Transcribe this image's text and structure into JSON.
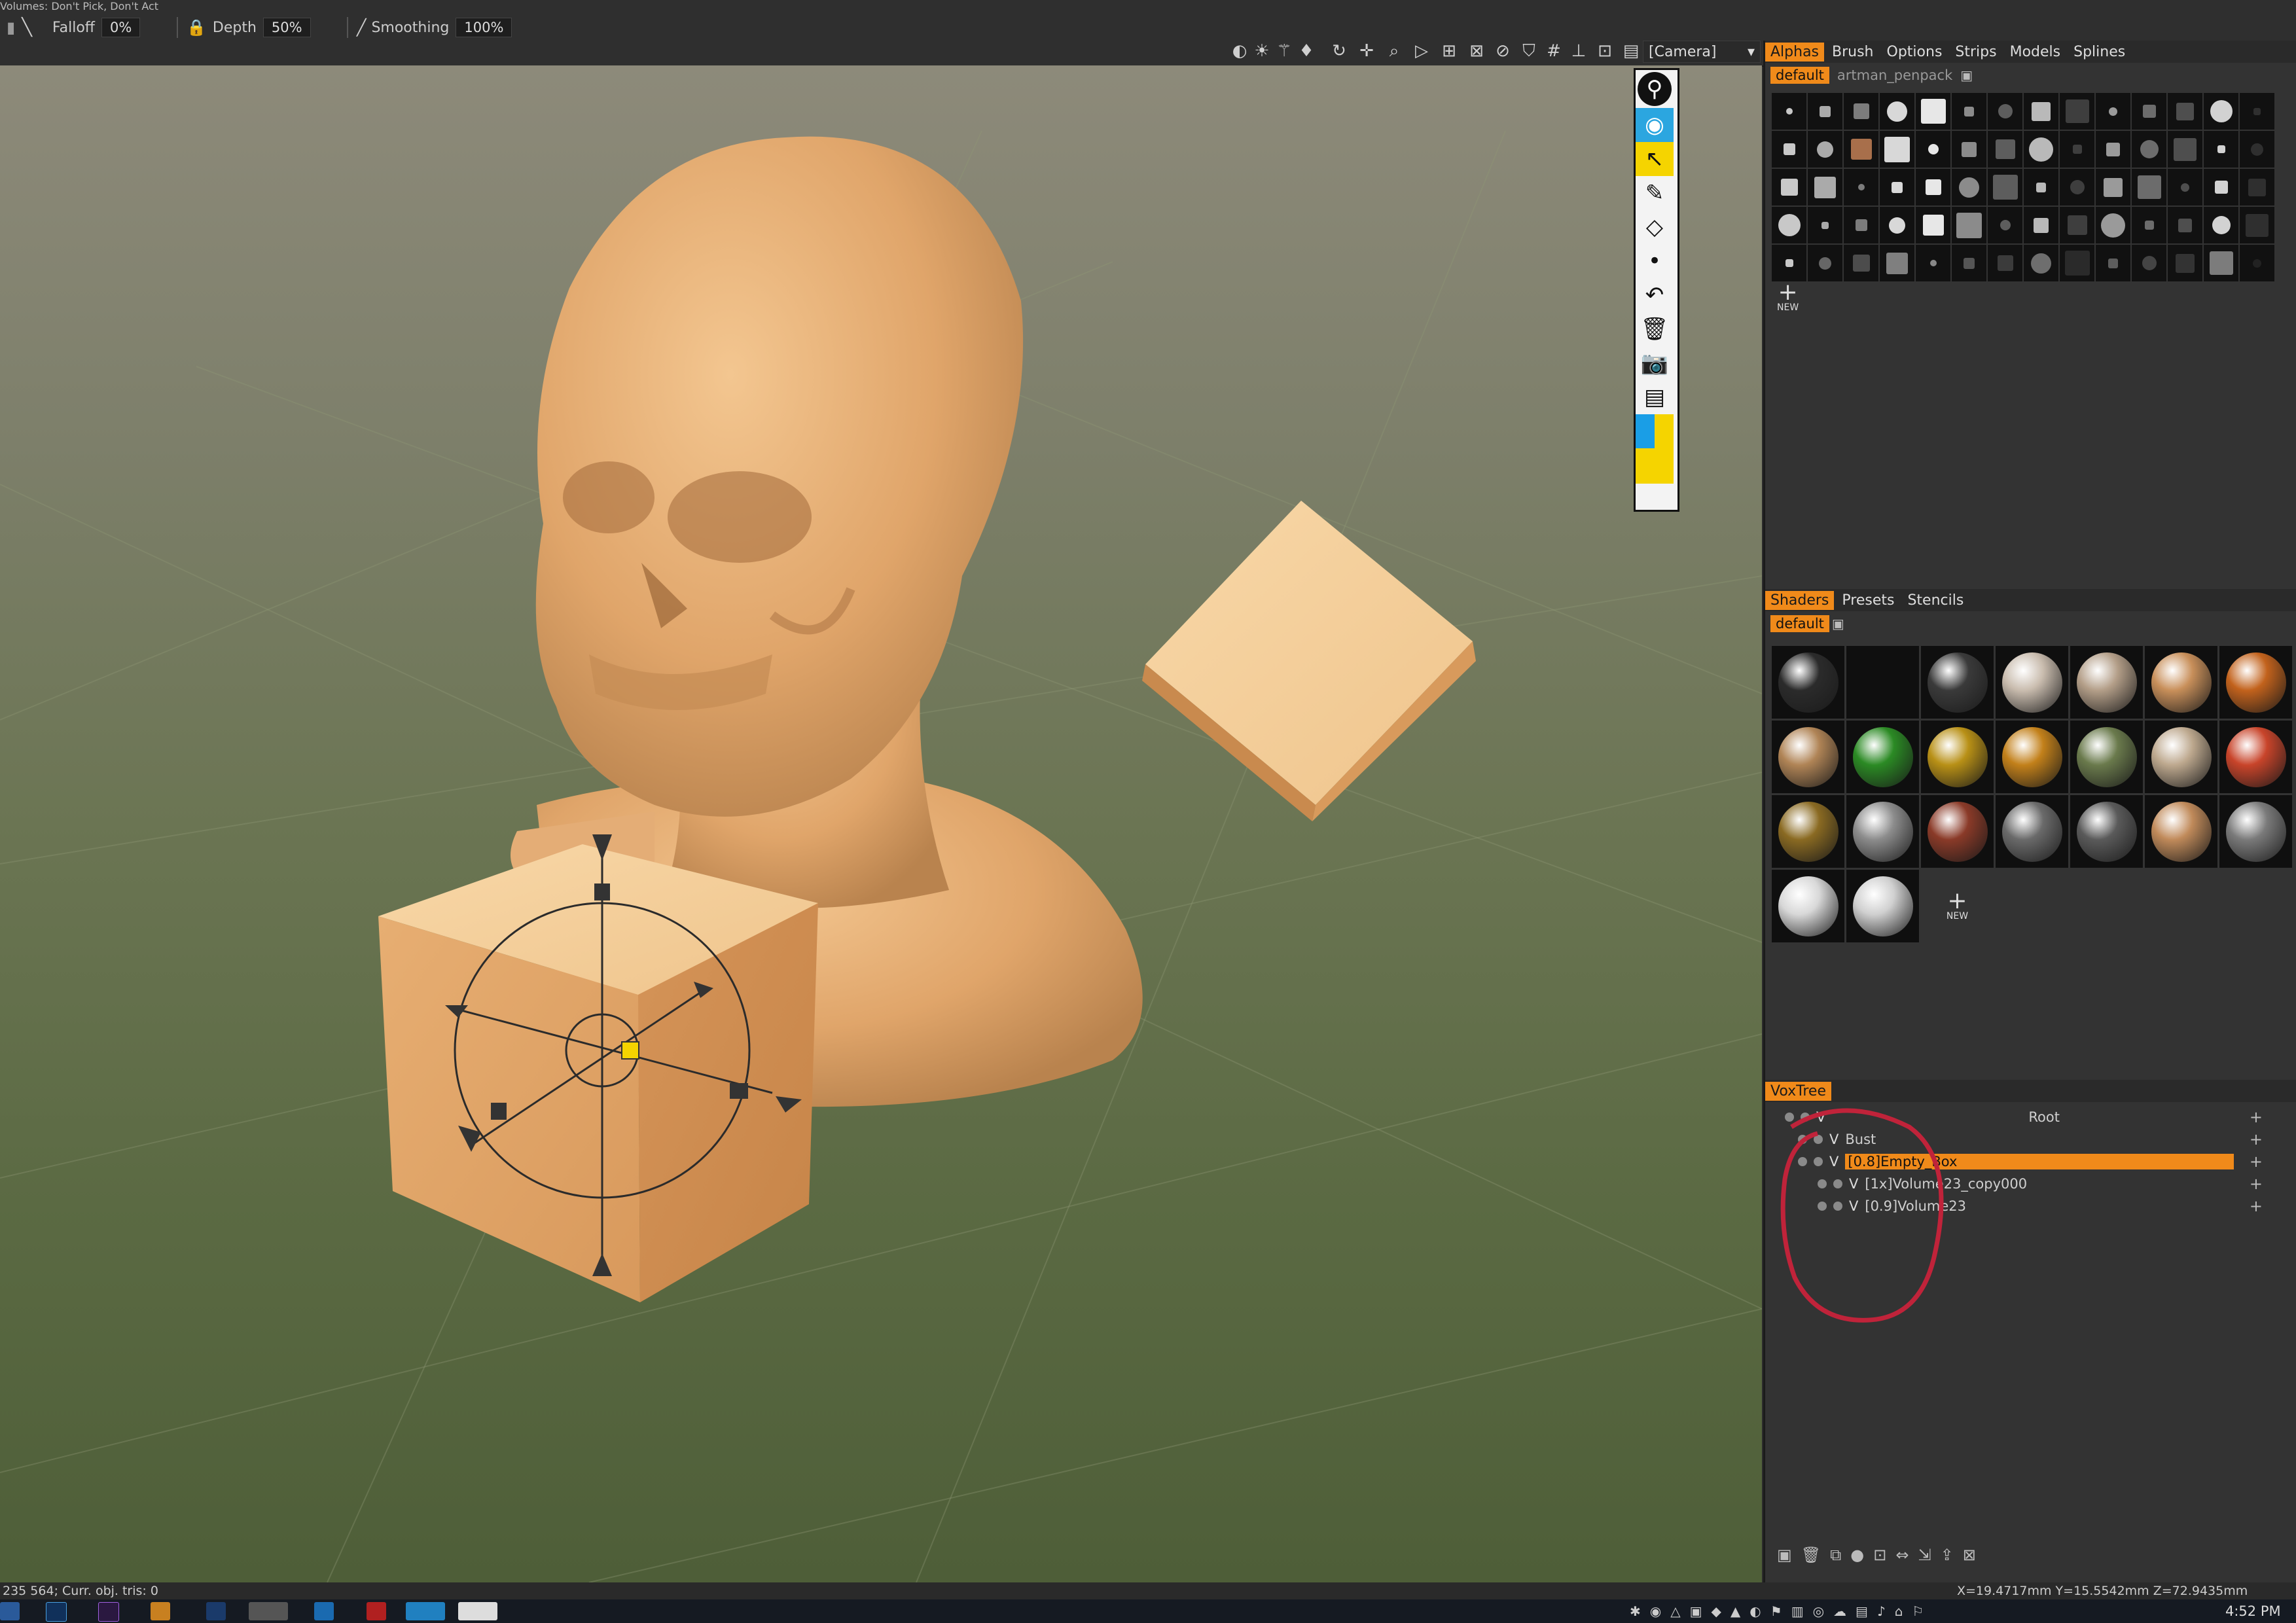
{
  "menu": {
    "volumes_text": "Volumes:   Don't Pick, Don't Act"
  },
  "toolbar": {
    "falloff_label": "Falloff",
    "falloff_value": "0%",
    "depth_label": "Depth",
    "depth_value": "50%",
    "smoothing_label": "Smoothing",
    "smoothing_value": "100%",
    "camera": "[Camera]"
  },
  "alphas_panel": {
    "tabs": [
      "Alphas",
      "Brush",
      "Options",
      "Strips",
      "Models",
      "Splines"
    ],
    "subtabs": [
      "default",
      "artman_penpack"
    ],
    "new_label": "NEW"
  },
  "shaders_panel": {
    "tabs": [
      "Shaders",
      "Presets",
      "Stencils"
    ],
    "subtab": "default",
    "new_label": "NEW",
    "colors": [
      "#2b2b2b",
      "#0a0a0a",
      "#3a3a3a",
      "#c9bcae",
      "#b39e88",
      "#c88f5a",
      "#c2621c",
      "#b08456",
      "#2b8a24",
      "#b89016",
      "#c2801a",
      "#6a7a4c",
      "#bda88e",
      "#c8442a",
      "#8a6a22",
      "#8c8c8c",
      "#8a3a28",
      "#6a6a6a",
      "#5a5a5a",
      "#c08a5a",
      "#7a7a7a",
      "#d8d8d8",
      "#d0d0d0"
    ]
  },
  "voxtree": {
    "tab": "VoxTree",
    "root": "Root",
    "items": [
      "Bust",
      "[0.8]Empty_Box",
      "[1x]Volume23_copy000",
      "[0.9]Volume23"
    ]
  },
  "status": {
    "left": "235 564; Curr. obj. tris: 0",
    "right": "X=19.4717mm  Y=15.5542mm  Z=72.9435mm"
  },
  "taskbar": {
    "clock": "4:52 PM"
  },
  "accent_color": "#f08a1a",
  "annotation_color": "#c0233a"
}
